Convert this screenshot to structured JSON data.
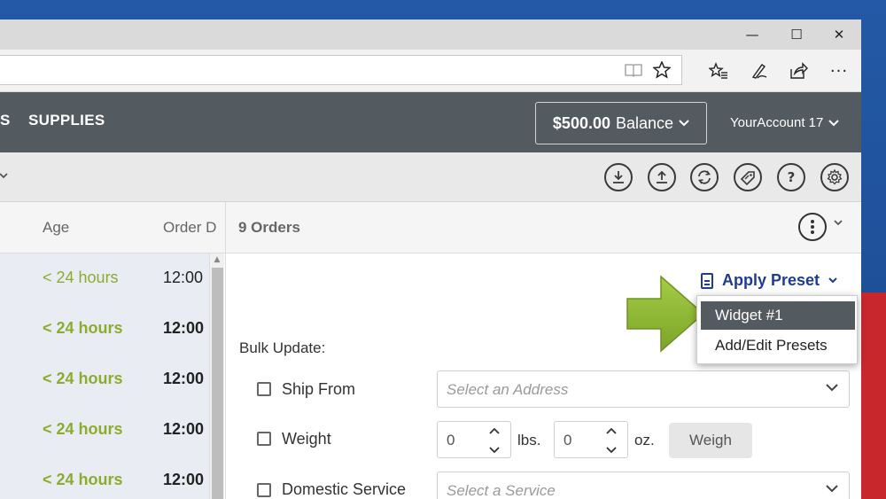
{
  "browser": {
    "window_controls": [
      "—",
      "☐",
      "✕"
    ]
  },
  "header": {
    "nav_partial": "S",
    "nav_supplies": "SUPPLIES",
    "balance_amount": "$500.00",
    "balance_label": "Balance",
    "account": "YourAccount 17"
  },
  "grid": {
    "col_age": "Age",
    "col_order_date": "Order D",
    "rows": [
      {
        "age": "< 24 hours",
        "date": "12:00",
        "bold": false
      },
      {
        "age": "< 24 hours",
        "date": "12:00",
        "bold": true
      },
      {
        "age": "< 24 hours",
        "date": "12:00",
        "bold": true
      },
      {
        "age": "< 24 hours",
        "date": "12:00",
        "bold": true
      },
      {
        "age": "< 24 hours",
        "date": "12:00",
        "bold": true
      }
    ]
  },
  "panel": {
    "orders_count": "9 Orders",
    "apply_preset": "Apply Preset",
    "bulk_update": "Bulk Update:",
    "ship_from": "Ship From",
    "ship_from_placeholder": "Select an Address",
    "weight": "Weight",
    "weight_lbs_value": "0",
    "weight_lbs_unit": "lbs.",
    "weight_oz_value": "0",
    "weight_oz_unit": "oz.",
    "weigh_button": "Weigh",
    "domestic_service": "Domestic Service",
    "service_placeholder": "Select a Service"
  },
  "preset_menu": {
    "items": [
      "Widget #1",
      "Add/Edit Presets"
    ]
  },
  "colors": {
    "header_bg": "#535b61",
    "age_green": "#8dac2e",
    "preset_blue": "#1e3d8f",
    "arrow_green": "#8ab52f"
  }
}
